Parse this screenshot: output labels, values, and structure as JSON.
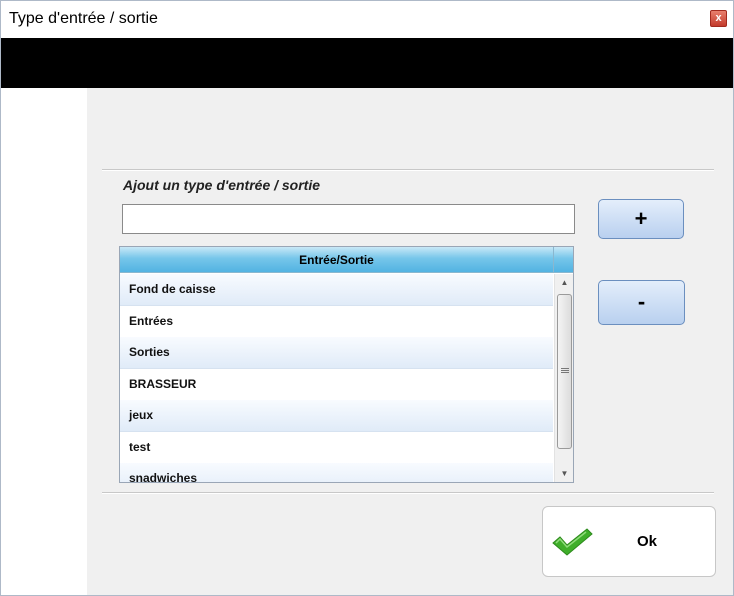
{
  "window": {
    "title": "Type d'entrée / sortie",
    "close_label": "x"
  },
  "form": {
    "add_label": "Ajout un type d'entrée / sortie",
    "input_value": "",
    "add_button_label": "+",
    "remove_button_label": "-"
  },
  "table": {
    "header": "Entrée/Sortie",
    "rows": [
      "Fond de caisse",
      "Entrées",
      "Sorties",
      "BRASSEUR",
      "jeux",
      "test",
      "snadwiches"
    ]
  },
  "footer": {
    "ok_label": "Ok",
    "ok_icon": "checkmark-icon"
  },
  "colors": {
    "accent": "#52b3e2",
    "button": "#b9d0ef",
    "check": "#3fae2a"
  }
}
